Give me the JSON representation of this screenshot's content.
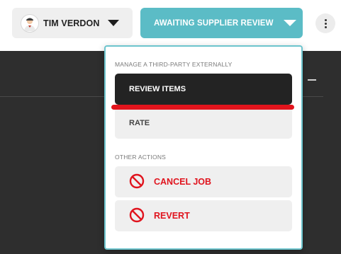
{
  "header": {
    "user": {
      "name": "TIM VERDON",
      "avatar_icon": "person-avatar-icon"
    },
    "status": {
      "label": "AWAITING SUPPLIER REVIEW",
      "color": "#5bbcc6"
    },
    "more_icon": "vertical-ellipsis-icon"
  },
  "menu": {
    "section_manage": "MANAGE A THIRD-PARTY EXTERNALLY",
    "review_items": "REVIEW ITEMS",
    "rate": "RATE",
    "section_other": "OTHER ACTIONS",
    "cancel_job": "CANCEL JOB",
    "revert": "REVERT",
    "danger_color": "#e0141e",
    "danger_icon": "ban-icon"
  },
  "background_panel": {
    "collapse_icon": "minus-icon"
  }
}
